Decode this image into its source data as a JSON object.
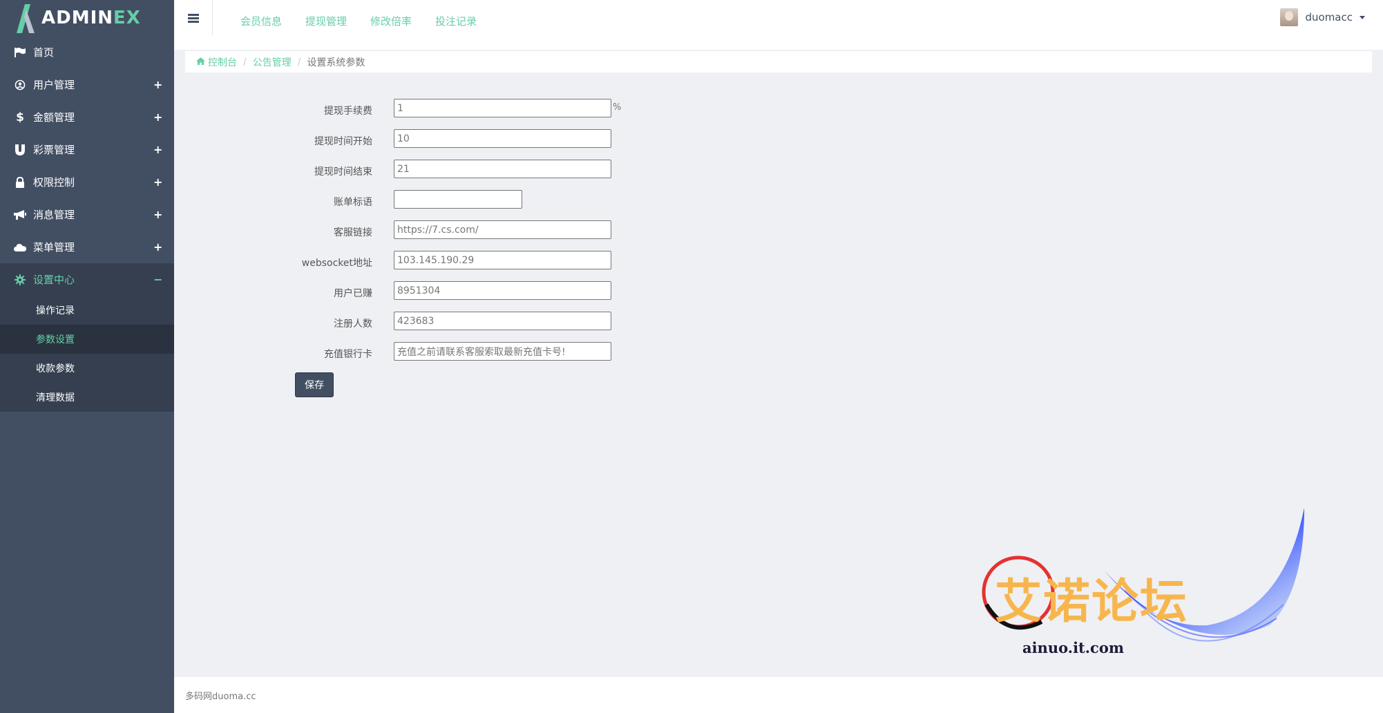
{
  "brand": {
    "name_prefix": "ADMIN",
    "name_suffix": "EX"
  },
  "sidebar": {
    "items": [
      {
        "label": "首页",
        "icon": "flag-icon",
        "toggle": ""
      },
      {
        "label": "用户管理",
        "icon": "user-circle-icon",
        "toggle": "+"
      },
      {
        "label": "金额管理",
        "icon": "dollar-icon",
        "toggle": "+"
      },
      {
        "label": "彩票管理",
        "icon": "magnet-icon",
        "toggle": "+"
      },
      {
        "label": "权限控制",
        "icon": "lock-icon",
        "toggle": "+"
      },
      {
        "label": "消息管理",
        "icon": "bullhorn-icon",
        "toggle": "+"
      },
      {
        "label": "菜单管理",
        "icon": "cloud-icon",
        "toggle": "+"
      },
      {
        "label": "设置中心",
        "icon": "gear-icon",
        "toggle": "−"
      }
    ],
    "submenu": [
      {
        "label": "操作记录"
      },
      {
        "label": "参数设置"
      },
      {
        "label": "收款参数"
      },
      {
        "label": "清理数据"
      }
    ]
  },
  "topnav": {
    "links": [
      "会员信息",
      "提现管理",
      "修改倍率",
      "投注记录"
    ]
  },
  "user": {
    "name": "duomacc"
  },
  "breadcrumb": {
    "home": "控制台",
    "parent": "公告管理",
    "current": "设置系统参数"
  },
  "form": {
    "fields": [
      {
        "label": "提现手续费",
        "value": "1",
        "unit": "%"
      },
      {
        "label": "提现时间开始",
        "value": "10"
      },
      {
        "label": "提现时间结束",
        "value": "21"
      },
      {
        "label": "账单标语",
        "value": ""
      },
      {
        "label": "客服链接",
        "value": "https://7.cs.com/"
      },
      {
        "label": "websocket地址",
        "value": "103.145.190.29"
      },
      {
        "label": "用户已赚",
        "value": "8951304"
      },
      {
        "label": "注册人数",
        "value": "423683"
      },
      {
        "label": "充值银行卡",
        "value": "充值之前请联系客服索取最新充值卡号!"
      }
    ],
    "save_label": "保存"
  },
  "watermark": {
    "text": "艾诺论坛",
    "url": "ainuo.it.com"
  },
  "footer": {
    "text": "多码网duoma.cc"
  },
  "colors": {
    "sidebar_bg": "#424f63",
    "accent": "#65cea7",
    "page_bg": "#eff0f4"
  }
}
